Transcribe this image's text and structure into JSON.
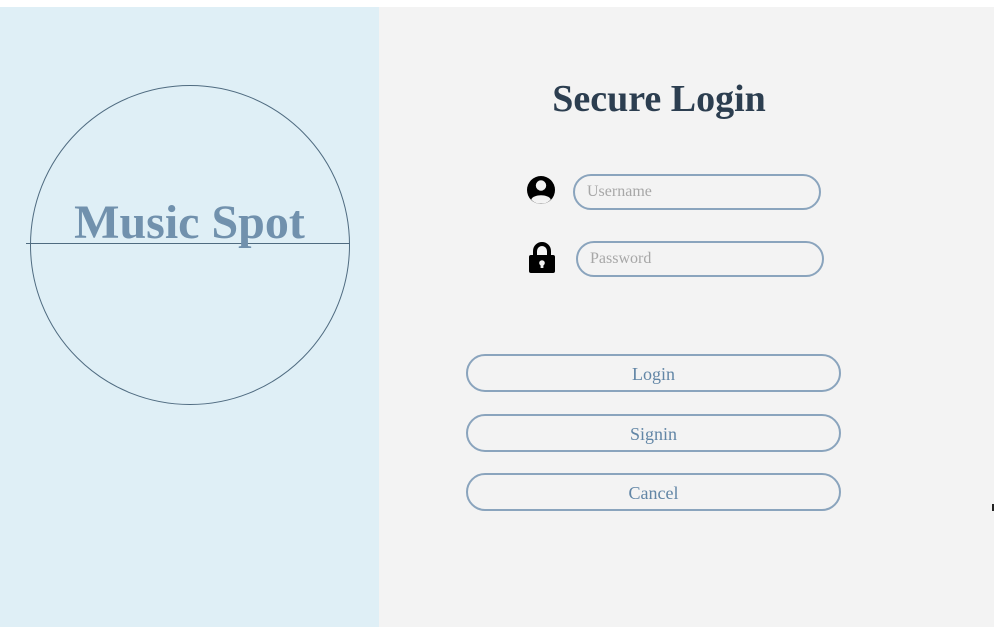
{
  "logo": {
    "text": "Music Spot"
  },
  "login": {
    "title": "Secure Login",
    "username_placeholder": "Username",
    "password_placeholder": "Password",
    "login_label": "Login",
    "signin_label": "Signin",
    "cancel_label": "Cancel"
  },
  "icons": {
    "username": "user-circle-icon",
    "password": "lock-icon"
  },
  "colors": {
    "left_panel_bg": "#dfeff6",
    "right_panel_bg": "#f3f3f3",
    "logo_text": "#7191ad",
    "title_text": "#2c3e50",
    "button_border": "#8aa4bd",
    "button_text": "#6286a6"
  }
}
